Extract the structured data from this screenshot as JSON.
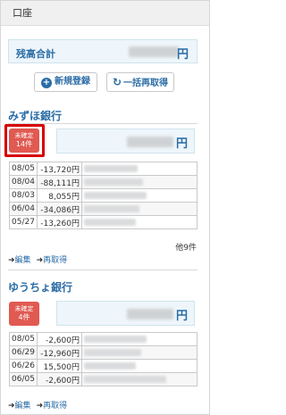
{
  "header": {
    "title": "口座"
  },
  "total": {
    "label": "残高合計",
    "yen": "円"
  },
  "buttons": {
    "new": "新規登録",
    "refresh": "一括再取得"
  },
  "banks": [
    {
      "name": "みずほ銀行",
      "pending_label": "未確定",
      "pending_count": "14件",
      "yen": "円",
      "transactions": [
        {
          "date": "08/05",
          "amount": "-13,720円"
        },
        {
          "date": "08/04",
          "amount": "-88,111円"
        },
        {
          "date": "08/03",
          "amount": "8,055円"
        },
        {
          "date": "06/04",
          "amount": "-34,086円"
        },
        {
          "date": "05/27",
          "amount": "-13,260円"
        }
      ],
      "more": "他9件",
      "edit": "編集",
      "reload": "再取得"
    },
    {
      "name": "ゆうちょ銀行",
      "pending_label": "未確定",
      "pending_count": "4件",
      "yen": "円",
      "transactions": [
        {
          "date": "08/05",
          "amount": "-2,600円"
        },
        {
          "date": "06/29",
          "amount": "-12,960円"
        },
        {
          "date": "06/26",
          "amount": "15,500円"
        },
        {
          "date": "06/05",
          "amount": "-2,600円"
        }
      ],
      "edit": "編集",
      "reload": "再取得"
    }
  ],
  "colors": {
    "accent": "#2a6ca6",
    "badge": "#e05a52",
    "highlight": "#d60000"
  },
  "icons": {
    "new": "plus-circle-icon",
    "refresh": "refresh-icon",
    "link_arrow": "arrow-right-icon"
  }
}
